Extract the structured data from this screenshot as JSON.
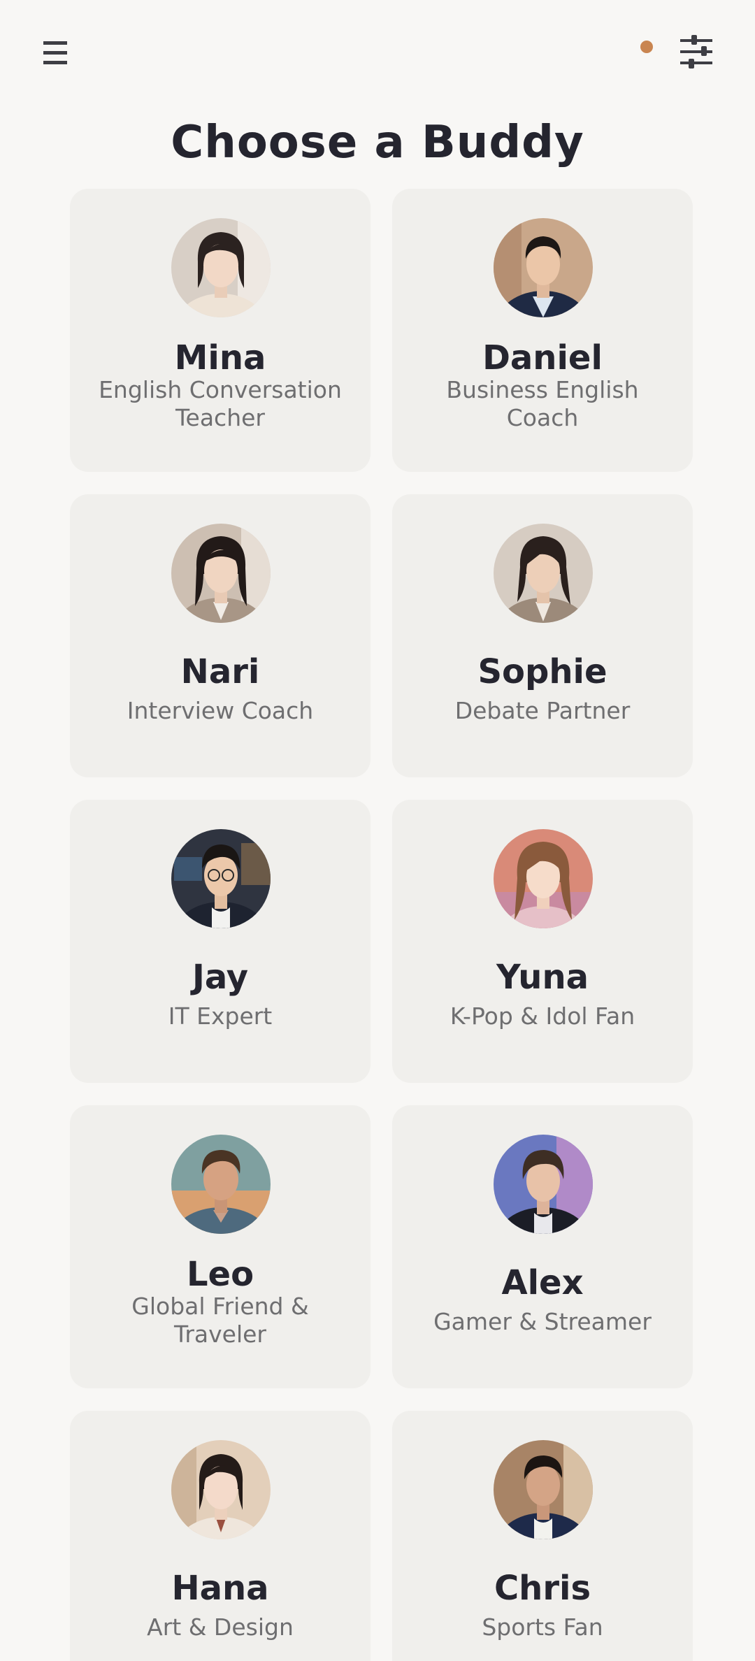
{
  "header": {
    "menu_icon": "hamburger-menu-icon",
    "filter_icon": "sliders-filter-icon",
    "notification_color": "#C98550"
  },
  "title": "Choose a Buddy",
  "buddies": [
    {
      "name": "Mina",
      "role": "English Conversation Teacher"
    },
    {
      "name": "Daniel",
      "role": "Business English Coach"
    },
    {
      "name": "Nari",
      "role": "Interview Coach"
    },
    {
      "name": "Sophie",
      "role": "Debate Partner"
    },
    {
      "name": "Jay",
      "role": "IT Expert"
    },
    {
      "name": "Yuna",
      "role": "K-Pop & Idol Fan"
    },
    {
      "name": "Leo",
      "role": "Global Friend & Traveler"
    },
    {
      "name": "Alex",
      "role": "Gamer & Streamer"
    },
    {
      "name": "Hana",
      "role": "Art & Design"
    },
    {
      "name": "Chris",
      "role": "Sports Fan"
    }
  ],
  "colors": {
    "background": "#F8F7F5",
    "card": "#F0EFEC",
    "text": "#25252F",
    "subtext": "#6E6E70"
  }
}
